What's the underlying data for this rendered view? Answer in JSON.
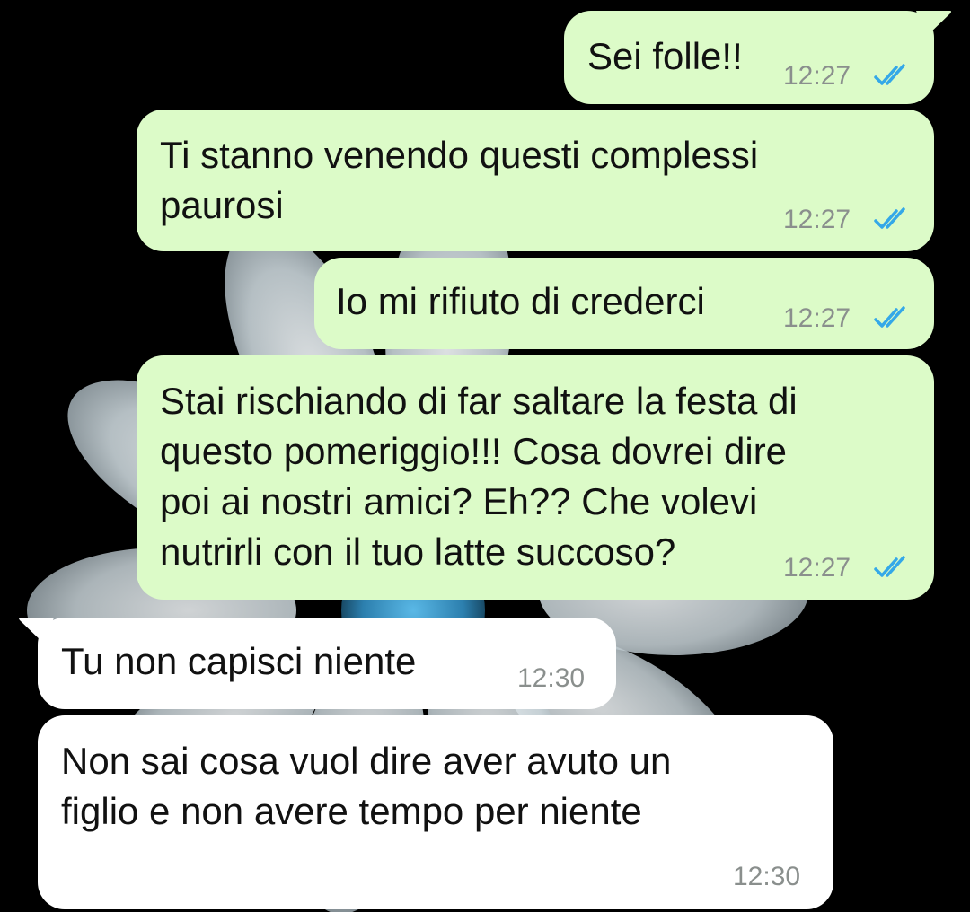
{
  "chat": {
    "wallpaper": "white-flower-on-black",
    "colors": {
      "outgoing_bubble": "#dcfbc8",
      "incoming_bubble": "#ffffff",
      "read_ticks": "#34a8e8",
      "timestamp": "#8a8f8d",
      "background": "#000000"
    },
    "messages": [
      {
        "direction": "outgoing",
        "lines": [
          "Sei folle!!"
        ],
        "time": "12:27",
        "status": "read-double-tick-icon"
      },
      {
        "direction": "outgoing",
        "lines": [
          "Ti stanno venendo questi complessi",
          "paurosi"
        ],
        "time": "12:27",
        "status": "read-double-tick-icon"
      },
      {
        "direction": "outgoing",
        "lines": [
          "Io mi rifiuto di crederci"
        ],
        "time": "12:27",
        "status": "read-double-tick-icon"
      },
      {
        "direction": "outgoing",
        "lines": [
          "Stai rischiando di far saltare la festa di",
          "questo pomeriggio!!! Cosa dovrei dire",
          "poi ai nostri amici? Eh?? Che volevi",
          "nutrirli con il tuo latte succoso?"
        ],
        "time": "12:27",
        "status": "read-double-tick-icon"
      },
      {
        "direction": "incoming",
        "lines": [
          "Tu non capisci niente"
        ],
        "time": "12:30"
      },
      {
        "direction": "incoming",
        "lines": [
          "Non sai cosa vuol dire aver avuto un",
          "figlio e non avere tempo per niente"
        ],
        "time": "12:30"
      }
    ]
  }
}
